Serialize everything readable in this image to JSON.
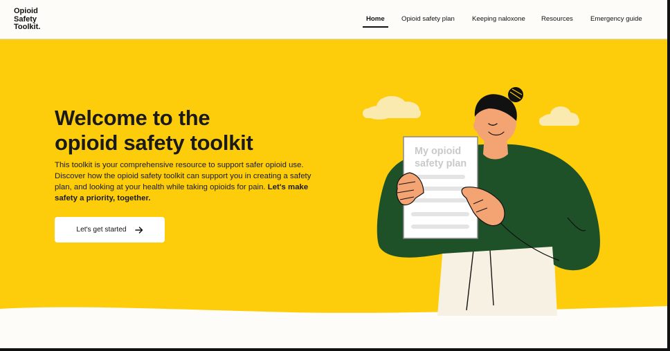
{
  "header": {
    "logo_lines": [
      "Opioid",
      "Safety",
      "Toolkit."
    ],
    "nav": [
      {
        "label": "Home",
        "active": true
      },
      {
        "label": "Opioid safety plan",
        "active": false
      },
      {
        "label": "Keeping naloxone",
        "active": false
      },
      {
        "label": "Resources",
        "active": false
      },
      {
        "label": "Emergency guide",
        "active": false
      }
    ]
  },
  "hero": {
    "title_line1": "Welcome to the",
    "title_line2": "opioid safety toolkit",
    "body": "This toolkit is your comprehensive resource to support safer opioid use. Discover how the opioid safety toolkit can support you in creating a safety plan, and looking at your health while taking opioids for pain.",
    "body_emphasis": "Let's make safety a priority, together.",
    "cta_label": "Let's get started",
    "cta_icon": "arrow-right-icon"
  },
  "illustration": {
    "document_title_line1": "My opioid",
    "document_title_line2": "safety plan"
  },
  "colors": {
    "hero_background": "#fdcd0c",
    "page_background": "#fdfcf8",
    "text": "#1a1a1a",
    "sweater": "#1f5128",
    "skin": "#f4a473",
    "cloud": "#fbeab0"
  }
}
